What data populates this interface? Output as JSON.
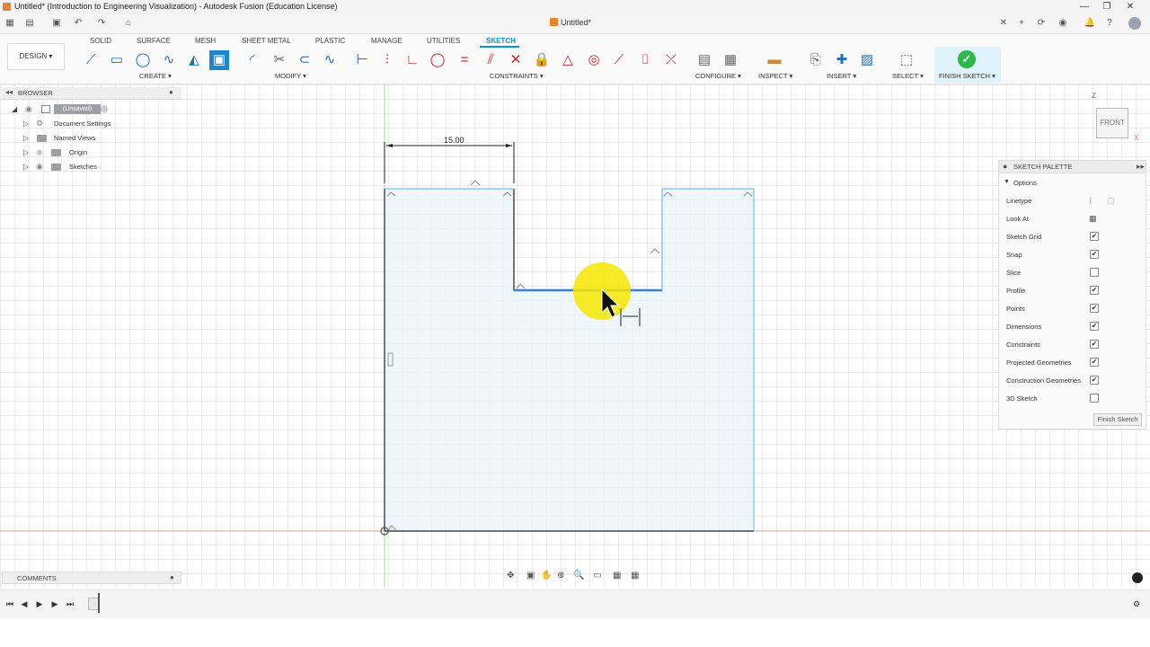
{
  "window": {
    "title": "Untitled* (Introduction to Engineering Visualization) - Autodesk Fusion (Education License)"
  },
  "document_tab": {
    "label": "Untitled*"
  },
  "toolbar": {
    "workspace": "DESIGN",
    "tabs": [
      "SOLID",
      "SURFACE",
      "MESH",
      "SHEET METAL",
      "PLASTIC",
      "MANAGE",
      "UTILITIES",
      "SKETCH"
    ],
    "active_tab": "SKETCH",
    "groups": {
      "create": "CREATE",
      "modify": "MODIFY",
      "constraints": "CONSTRAINTS",
      "configure": "CONFIGURE",
      "inspect": "INSPECT",
      "insert": "INSERT",
      "select": "SELECT",
      "finish_sketch": "FINISH SKETCH"
    },
    "accent_color": "#0696d7"
  },
  "browser": {
    "title": "BROWSER",
    "items": [
      {
        "label": "(Unsaved)"
      },
      {
        "label": "Document Settings"
      },
      {
        "label": "Named Views"
      },
      {
        "label": "Origin"
      },
      {
        "label": "Sketches"
      }
    ]
  },
  "viewcube": {
    "face": "FRONT",
    "axis_z": "Z",
    "axis_x": "X"
  },
  "sketch": {
    "dimension_label": "15.00",
    "profile_fill": "#eaf4fb",
    "line_color": "#6fc3ea",
    "constrained_color": "#222222"
  },
  "sketch_palette": {
    "title": "SKETCH PALETTE",
    "section": "Options",
    "options": [
      {
        "label": "Linetype",
        "type": "icons"
      },
      {
        "label": "Look At",
        "type": "button"
      },
      {
        "label": "Sketch Grid",
        "checked": true
      },
      {
        "label": "Snap",
        "checked": true
      },
      {
        "label": "Slice",
        "checked": false
      },
      {
        "label": "Profile",
        "checked": true
      },
      {
        "label": "Points",
        "checked": true
      },
      {
        "label": "Dimensions",
        "checked": true
      },
      {
        "label": "Constraints",
        "checked": true
      },
      {
        "label": "Projected Geometries",
        "checked": true
      },
      {
        "label": "Construction Geometries",
        "checked": true
      },
      {
        "label": "3D Sketch",
        "checked": false
      }
    ],
    "finish_button": "Finish Sketch"
  },
  "comments": {
    "title": "COMMENTS"
  }
}
